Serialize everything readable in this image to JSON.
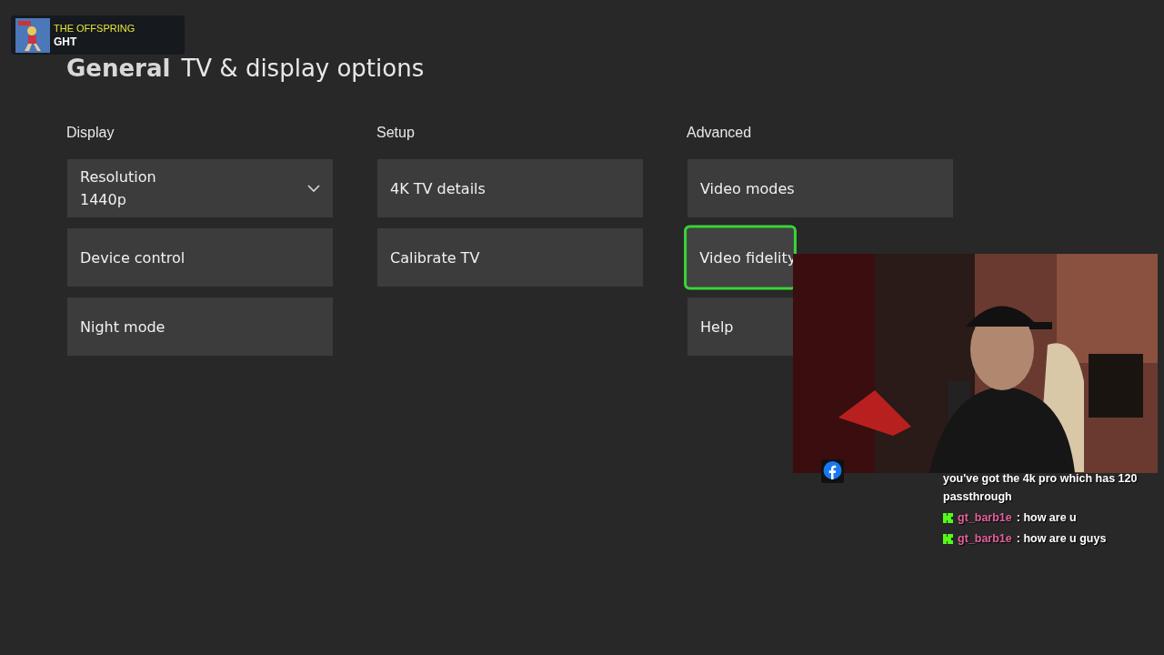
{
  "header": {
    "section": "General",
    "title": "TV & display options"
  },
  "columns": [
    {
      "heading": "Display",
      "tiles": [
        {
          "kind": "dropdown",
          "label": "Resolution",
          "value": "1440p",
          "selected": false
        },
        {
          "kind": "link",
          "label": "Device control",
          "selected": false
        },
        {
          "kind": "link",
          "label": "Night mode",
          "selected": false
        }
      ]
    },
    {
      "heading": "Setup",
      "tiles": [
        {
          "kind": "link",
          "label": "4K TV details",
          "selected": false
        },
        {
          "kind": "link",
          "label": "Calibrate TV",
          "selected": false
        }
      ]
    },
    {
      "heading": "Advanced",
      "tiles": [
        {
          "kind": "link",
          "label": "Video modes",
          "selected": false
        },
        {
          "kind": "link",
          "label": "Video fidelity",
          "selected": true
        },
        {
          "kind": "link",
          "label": "Help",
          "selected": false
        }
      ]
    }
  ],
  "now_playing": {
    "artist": "THE OFFSPRING",
    "track": "GHT"
  },
  "chat": [
    {
      "kind": "continuation",
      "message": "you've got the 4k pro which has 120 passthrough"
    },
    {
      "kind": "message",
      "user": "gt_barb1e",
      "message": ": how are u"
    },
    {
      "kind": "message",
      "user": "gt_barb1e",
      "message": ": how are u guys"
    }
  ]
}
